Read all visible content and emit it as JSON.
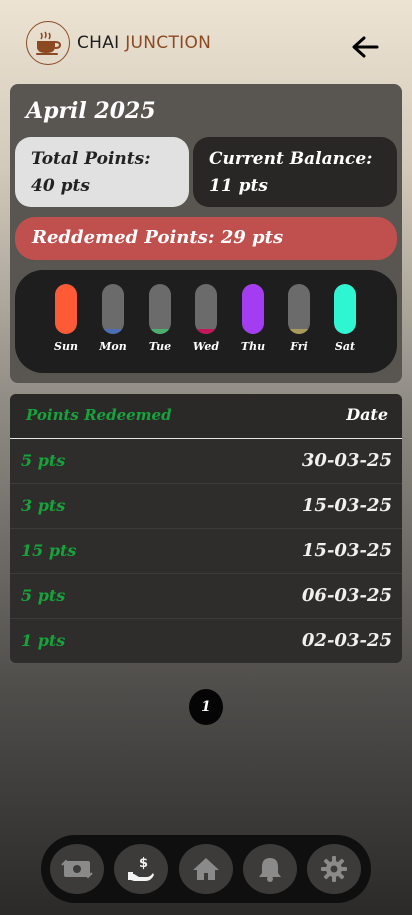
{
  "header": {
    "brand_part1": "CHAI",
    "brand_part2": "JUNCTION"
  },
  "summary": {
    "month": "April 2025",
    "total_points": "Total Points: 40 pts",
    "current_balance": "Current Balance: 11 pts",
    "redeemed_points": "Reddemed Points: 29 pts"
  },
  "week": [
    {
      "label": "Sun",
      "color": "#ff5a36",
      "level": 1.0
    },
    {
      "label": "Mon",
      "color": "#4a6fb5",
      "level": 0.1
    },
    {
      "label": "Tue",
      "color": "#4caf6e",
      "level": 0.1
    },
    {
      "label": "Wed",
      "color": "#c2185b",
      "level": 0.1
    },
    {
      "label": "Thu",
      "color": "#a43cf2",
      "level": 1.0
    },
    {
      "label": "Fri",
      "color": "#a89a5a",
      "level": 0.1
    },
    {
      "label": "Sat",
      "color": "#2ef5d2",
      "level": 1.0
    }
  ],
  "table": {
    "header_left": "Points Redeemed",
    "header_right": "Date",
    "rows": [
      {
        "points": "5 pts",
        "date": "30-03-25"
      },
      {
        "points": "3 pts",
        "date": "15-03-25"
      },
      {
        "points": "15 pts",
        "date": "15-03-25"
      },
      {
        "points": "5 pts",
        "date": "06-03-25"
      },
      {
        "points": "1 pts",
        "date": "02-03-25"
      }
    ]
  },
  "pagination": {
    "current_page": "1"
  },
  "bottom_nav": [
    "exchange-money-icon",
    "hand-dollar-icon",
    "home-icon",
    "bell-icon",
    "gear-icon"
  ]
}
